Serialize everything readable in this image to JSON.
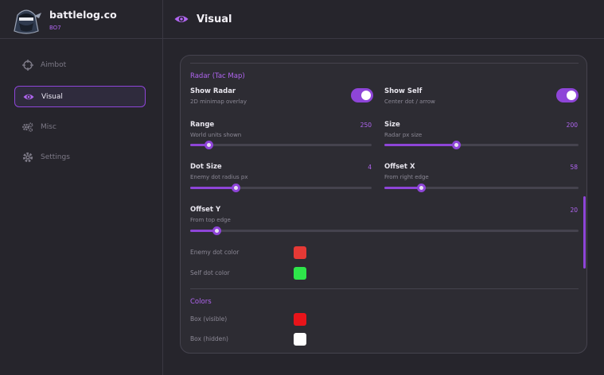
{
  "brand": {
    "title": "battlelog.co",
    "subtitle": "BO7"
  },
  "sidebar": {
    "items": [
      {
        "label": "Aimbot",
        "icon": "crosshair-icon",
        "active": false
      },
      {
        "label": "Visual",
        "icon": "eye-icon",
        "active": true
      },
      {
        "label": "Misc",
        "icon": "gears-icon",
        "active": false
      },
      {
        "label": "Settings",
        "icon": "gear-icon",
        "active": false
      }
    ]
  },
  "header": {
    "title": "Visual",
    "icon": "eye-icon"
  },
  "panel": {
    "radar": {
      "title": "Radar (Tac Map)",
      "show_radar": {
        "label": "Show Radar",
        "desc": "2D minimap overlay",
        "on": true
      },
      "show_self": {
        "label": "Show Self",
        "desc": "Center dot / arrow",
        "on": true
      },
      "range": {
        "label": "Range",
        "desc": "World units shown",
        "value": "250",
        "fraction": 0.1
      },
      "size": {
        "label": "Size",
        "desc": "Radar px size",
        "value": "200",
        "fraction": 0.37
      },
      "dot_size": {
        "label": "Dot Size",
        "desc": "Enemy dot radius px",
        "value": "4",
        "fraction": 0.25
      },
      "offset_x": {
        "label": "Offset X",
        "desc": "From right edge",
        "value": "58",
        "fraction": 0.19
      },
      "offset_y": {
        "label": "Offset Y",
        "desc": "From top edge",
        "value": "20",
        "fraction": 0.067
      },
      "enemy_dot_color": {
        "label": "Enemy dot color",
        "color": "#e53935"
      },
      "self_dot_color": {
        "label": "Self dot color",
        "color": "#2ee64a"
      }
    },
    "colors": {
      "title": "Colors",
      "box_visible": {
        "label": "Box (visible)",
        "color": "#e8141a"
      },
      "box_hidden": {
        "label": "Box (hidden)",
        "color": "#ffffff"
      }
    }
  },
  "theme": {
    "accent": "#8e45d8",
    "accent_text": "#b065f0",
    "background": "#26252c",
    "panel": "#2d2c33"
  }
}
